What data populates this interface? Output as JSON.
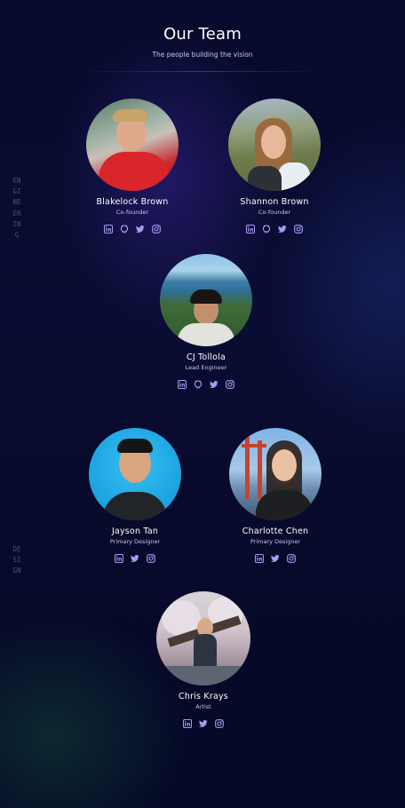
{
  "header": {
    "title": "Our Team",
    "subtitle": "The people building the vision"
  },
  "sections": [
    {
      "label": "ENGINEERING"
    },
    {
      "label": "DESIGN"
    }
  ],
  "members": [
    {
      "name": "Blakelock Brown",
      "role": "Co-founder",
      "socials": [
        "linkedin-icon",
        "github-icon",
        "twitter-icon",
        "instagram-icon"
      ]
    },
    {
      "name": "Shannon Brown",
      "role": "Co-founder",
      "socials": [
        "linkedin-icon",
        "github-icon",
        "twitter-icon",
        "instagram-icon"
      ]
    },
    {
      "name": "CJ Tollola",
      "role": "Lead Engineer",
      "socials": [
        "linkedin-icon",
        "github-icon",
        "twitter-icon",
        "instagram-icon"
      ]
    },
    {
      "name": "Jayson Tan",
      "role": "Primary Designer",
      "socials": [
        "linkedin-icon",
        "twitter-icon",
        "instagram-icon"
      ]
    },
    {
      "name": "Charlotte Chen",
      "role": "Primary Designer",
      "socials": [
        "linkedin-icon",
        "twitter-icon",
        "instagram-icon"
      ]
    },
    {
      "name": "Chris Krays",
      "role": "Artist",
      "socials": [
        "linkedin-icon",
        "twitter-icon",
        "instagram-icon"
      ]
    }
  ],
  "colors": {
    "accent": "#a99cf2",
    "background": "#080b2e"
  }
}
